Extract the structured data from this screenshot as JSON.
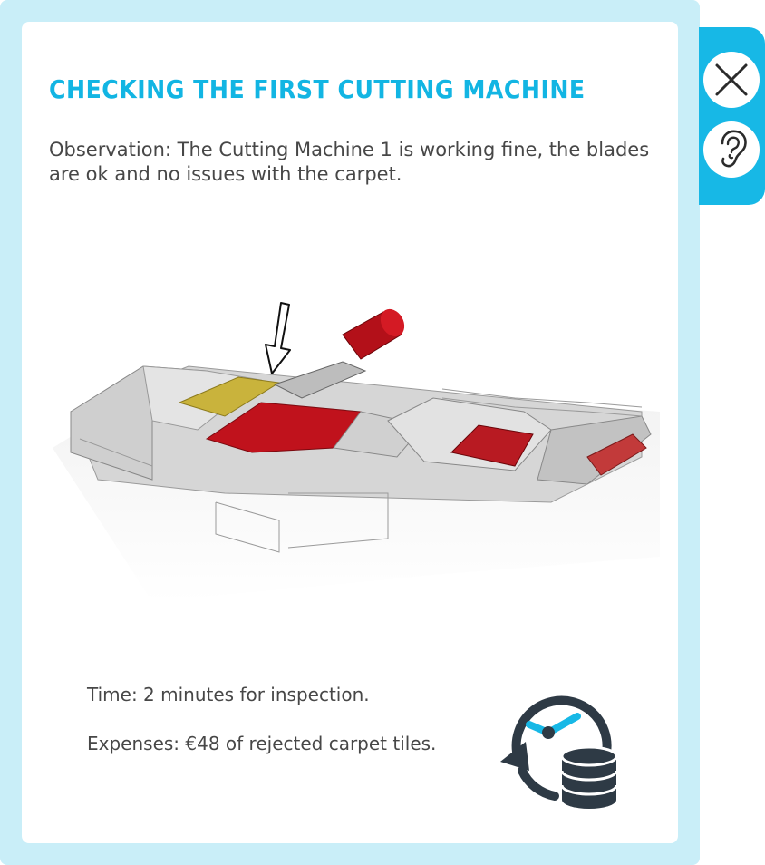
{
  "panel": {
    "title": "CHECKING THE FIRST CUTTING MACHINE",
    "observation": "Observation: The Cutting Machine 1 is working fine, the blades are ok and no issues with the carpet.",
    "time": "Time:  2 minutes for inspection.",
    "expenses": "Expenses: €48 of rejected carpet tiles."
  },
  "illustration": {
    "subject": "carpet-production-line",
    "pointer": "arrow-down-icon"
  },
  "sidebar": {
    "close_icon": "close-icon",
    "audio_icon": "ear-icon"
  },
  "colors": {
    "accent": "#12b5e3",
    "tab": "#17b8e6",
    "frame": "#c9eef8",
    "text": "#474747",
    "icon_dark": "#2e3a45",
    "carpet_red": "#c0121c"
  }
}
